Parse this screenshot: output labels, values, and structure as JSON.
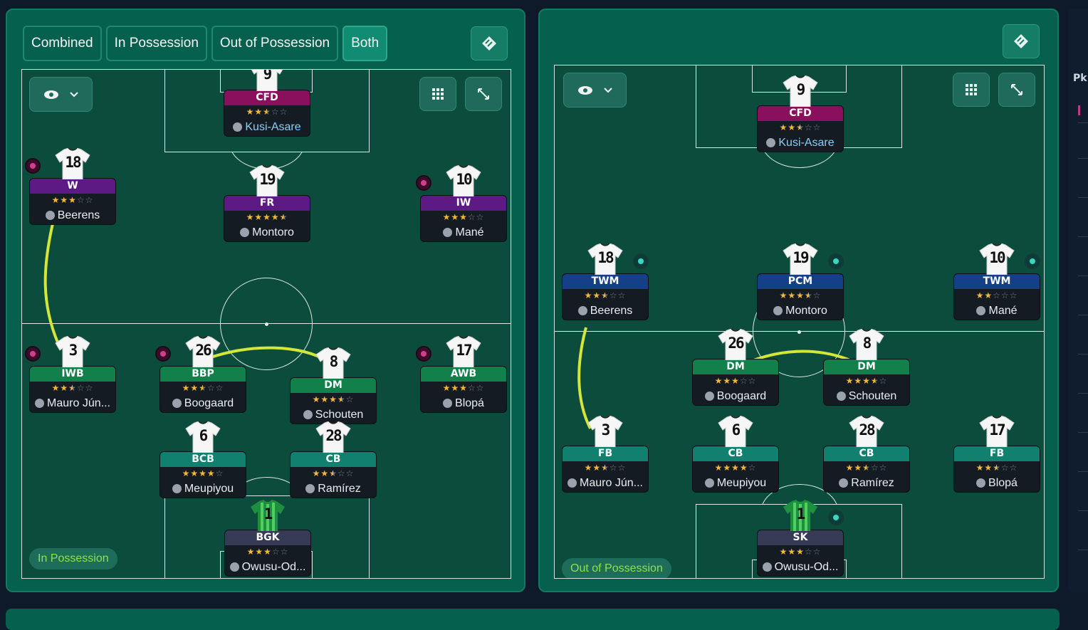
{
  "tabs": [
    {
      "label": "Combined",
      "active": false
    },
    {
      "label": "In Possession",
      "active": false
    },
    {
      "label": "Out of Possession",
      "active": false
    },
    {
      "label": "Both",
      "active": true
    }
  ],
  "left_panel": {
    "mode_label": "In Possession"
  },
  "right_panel": {
    "mode_label": "Out of Possession"
  },
  "sidebar": {
    "label": "Pk"
  },
  "colors": {
    "attack": "#8a0f5c",
    "forward": "#5a1e8a",
    "wide_mid": "#5d1a85",
    "mid_green": "#12804a",
    "def_teal": "#11806e",
    "gk": "#353b55",
    "twm": "#153f86",
    "link": "#d4e63a"
  },
  "players_in_possession": [
    {
      "shirt": "9",
      "role": "CFD",
      "stars": 2.5,
      "name": "Kusi-Asare",
      "color": "#8a0f5c",
      "highlight": true
    },
    {
      "shirt": "18",
      "role": "W",
      "stars": 3,
      "name": "Beerens",
      "color": "#5d1a85",
      "badge": "pink"
    },
    {
      "shirt": "19",
      "role": "FR",
      "stars": 4.5,
      "name": "Montoro",
      "color": "#5d1a85"
    },
    {
      "shirt": "10",
      "role": "IW",
      "stars": 3,
      "name": "Mané",
      "color": "#5d1a85",
      "badge": "pink"
    },
    {
      "shirt": "3",
      "role": "IWB",
      "stars": 2.5,
      "name": "Mauro Jún...",
      "color": "#12804a",
      "badge": "pink"
    },
    {
      "shirt": "26",
      "role": "BBP",
      "stars": 2.5,
      "name": "Boogaard",
      "color": "#12804a",
      "badge": "pink"
    },
    {
      "shirt": "8",
      "role": "DM",
      "stars": 3.5,
      "name": "Schouten",
      "color": "#12804a"
    },
    {
      "shirt": "17",
      "role": "AWB",
      "stars": 3,
      "name": "Blopá",
      "color": "#12804a",
      "badge": "pink"
    },
    {
      "shirt": "6",
      "role": "BCB",
      "stars": 4,
      "name": "Meupiyou",
      "color": "#11806e"
    },
    {
      "shirt": "28",
      "role": "CB",
      "stars": 2.5,
      "name": "Ramírez",
      "color": "#11806e"
    },
    {
      "shirt": "1",
      "role": "BGK",
      "stars": 3,
      "name": "Owusu-Od...",
      "color": "#353b55",
      "gk": true
    }
  ],
  "players_out_of_possession": [
    {
      "shirt": "9",
      "role": "CFD",
      "stars": 2.5,
      "name": "Kusi-Asare",
      "color": "#8a0f5c",
      "highlight": true
    },
    {
      "shirt": "18",
      "role": "TWM",
      "stars": 2.5,
      "name": "Beerens",
      "color": "#153f86",
      "badge": "teal"
    },
    {
      "shirt": "19",
      "role": "PCM",
      "stars": 3.5,
      "name": "Montoro",
      "color": "#153f86",
      "badge": "teal"
    },
    {
      "shirt": "10",
      "role": "TWM",
      "stars": 2,
      "name": "Mané",
      "color": "#153f86",
      "badge": "teal"
    },
    {
      "shirt": "26",
      "role": "DM",
      "stars": 3,
      "name": "Boogaard",
      "color": "#12804a"
    },
    {
      "shirt": "8",
      "role": "DM",
      "stars": 3.5,
      "name": "Schouten",
      "color": "#12804a"
    },
    {
      "shirt": "3",
      "role": "FB",
      "stars": 2.5,
      "name": "Mauro Jún...",
      "color": "#11806e"
    },
    {
      "shirt": "6",
      "role": "CB",
      "stars": 4,
      "name": "Meupiyou",
      "color": "#11806e"
    },
    {
      "shirt": "28",
      "role": "CB",
      "stars": 2.5,
      "name": "Ramírez",
      "color": "#11806e"
    },
    {
      "shirt": "17",
      "role": "FB",
      "stars": 2.5,
      "name": "Blopá",
      "color": "#11806e"
    },
    {
      "shirt": "1",
      "role": "SK",
      "stars": 3,
      "name": "Owusu-Od...",
      "color": "#353b55",
      "gk": true,
      "badge": "teal"
    }
  ]
}
